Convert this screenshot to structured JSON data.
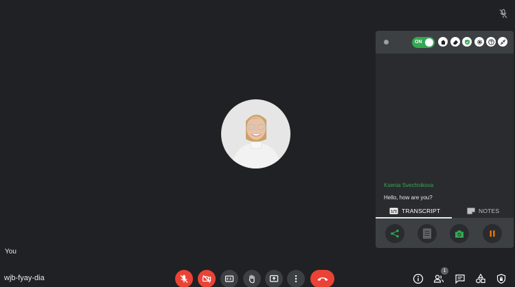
{
  "participant": {
    "self_label": "You"
  },
  "meeting": {
    "code": "wjb-fyay-dia"
  },
  "controls": {
    "participants_badge": "1"
  },
  "extension": {
    "toggle_label": "ON",
    "transcript": {
      "speaker": "Ksenia Svechnikova",
      "message": "Hello, how are you?"
    },
    "tabs": [
      {
        "label": "TRANSCRIPT"
      },
      {
        "label": "NOTES"
      }
    ]
  },
  "colors": {
    "background": "#202124",
    "danger": "#ea4335",
    "accent": "#34a853",
    "pause": "#f57c00"
  }
}
